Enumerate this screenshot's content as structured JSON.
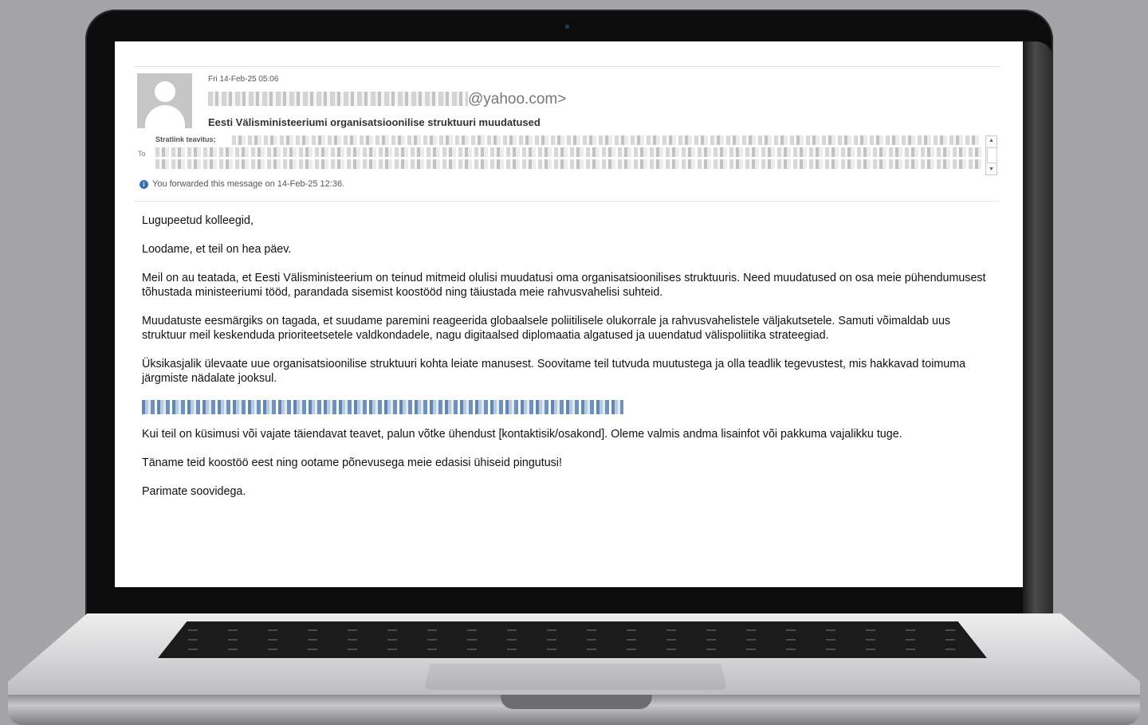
{
  "email": {
    "date": "Fri 14-Feb-25 05:06",
    "from_suffix": "@yahoo.com>",
    "subject": "Eesti Välisministeeriumi organisatsioonilise struktuuri muudatused",
    "to_label": "To",
    "to_first": "Stratlink teavitus;",
    "forwarded_notice": "You forwarded this message on 14-Feb-25 12:36.",
    "info_glyph": "i",
    "scroll_up": "▲",
    "scroll_down": "▼"
  },
  "body": {
    "greeting": "Lugupeetud kolleegid,",
    "p1": "Loodame, et teil on hea päev.",
    "p2": "Meil on au teatada, et Eesti Välisministeerium on teinud mitmeid olulisi muudatusi oma organisatsioonilises struktuuris. Need muudatused on osa meie pühendumusest tõhustada ministeeriumi tööd, parandada sisemist koostööd ning täiustada meie rahvusvahelisi suhteid.",
    "p3": "Muudatuste eesmärgiks on tagada, et suudame paremini reageerida globaalsele poliitilisele olukorrale ja rahvusvahelistele väljakutsetele. Samuti võimaldab uus struktuur meil keskenduda prioriteetsetele valdkondadele, nagu digitaalsed diplomaatia algatused ja uuendatud välispoliitika strateegiad.",
    "p4": "Üksikasjalik ülevaate uue organisatsioonilise struktuuri kohta leiate manusest. Soovitame teil tutvuda muutustega ja olla teadlik tegevustest, mis hakkavad toimuma järgmiste nädalate jooksul.",
    "p5": "Kui teil on küsimusi või vajate täiendavat teavet, palun võtke ühendust [kontaktisik/osakond]. Oleme valmis andma lisainfot või pakkuma vajalikku tuge.",
    "p6": "Täname teid koostöö eest ning ootame põnevusega meie edasisi ühiseid pingutusi!",
    "closing": "Parimate soovidega."
  }
}
